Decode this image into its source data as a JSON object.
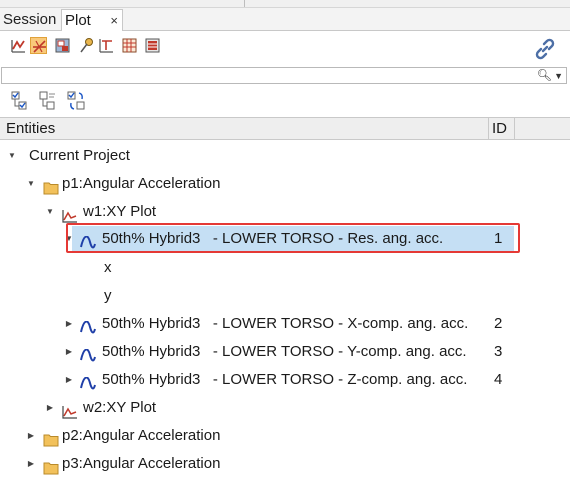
{
  "tabs": [
    {
      "label": "Session"
    },
    {
      "label": "Plot",
      "close_glyph": "×"
    }
  ],
  "toolbar_icons": [
    "curve-style-icon",
    "curve-active-icon",
    "page-layout-icon",
    "pin-icon",
    "measure-icon",
    "table-icon",
    "report-icon"
  ],
  "search": {
    "value": "",
    "placeholder": ""
  },
  "header": {
    "entities": "Entities",
    "id": "ID"
  },
  "tree": {
    "root": {
      "label": "Current Project"
    },
    "p1": {
      "label": "p1:Angular Acceleration"
    },
    "w1": {
      "label": "w1:XY Plot"
    },
    "c1": {
      "label": "50th% Hybrid3   - LOWER TORSO - Res. ang. acc.",
      "id": "1"
    },
    "x": {
      "label": "x"
    },
    "y": {
      "label": "y"
    },
    "c2": {
      "label": "50th% Hybrid3   - LOWER TORSO - X-comp. ang. acc.",
      "id": "2"
    },
    "c3": {
      "label": "50th% Hybrid3   - LOWER TORSO - Y-comp. ang. acc.",
      "id": "3"
    },
    "c4": {
      "label": "50th% Hybrid3   - LOWER TORSO - Z-comp. ang. acc.",
      "id": "4"
    },
    "w2": {
      "label": "w2:XY Plot"
    },
    "p2": {
      "label": "p2:Angular Acceleration"
    },
    "p3": {
      "label": "p3:Angular Acceleration"
    }
  },
  "colors": {
    "selection": "#c5dff4",
    "highlight": "#e53935",
    "curve": "#1f3fa8",
    "folder": "#f2c15b"
  }
}
